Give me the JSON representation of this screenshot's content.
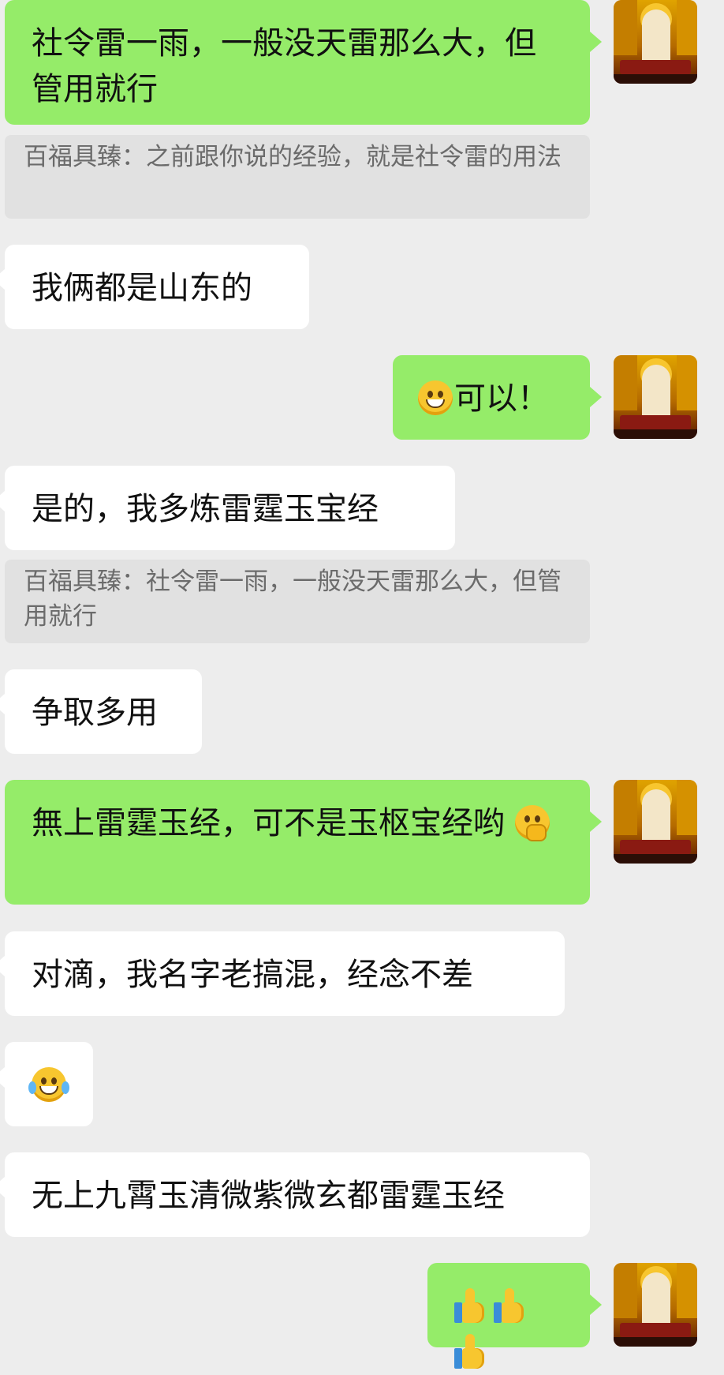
{
  "messages": {
    "m1": "社令雷一雨，一般没天雷那么大，但管用就行",
    "q1": "百福具臻：之前跟你说的经验，就是社令雷的用法",
    "m2": "我俩都是山东的",
    "m3": "可以！",
    "m4": "是的，我多炼雷霆玉宝经",
    "q2": "百福具臻：社令雷一雨，一般没天雷那么大，但管用就行",
    "m5": "争取多用",
    "m6": "無上雷霆玉经，可不是玉枢宝经哟",
    "m7": "对滴，我名字老搞混，经念不差",
    "m9": "无上九霄玉清微紫微玄都雷霆玉经"
  },
  "emojis": {
    "m3": "grinning-face",
    "m6": "face-with-hand-over-mouth",
    "m8": "face-with-tears-of-joy",
    "m10": [
      "thumbs-up",
      "thumbs-up",
      "thumbs-up"
    ]
  },
  "colors": {
    "self_bubble": "#95ec69",
    "other_bubble": "#ffffff",
    "quote_bg": "#e1e1e1",
    "background": "#ededed"
  }
}
